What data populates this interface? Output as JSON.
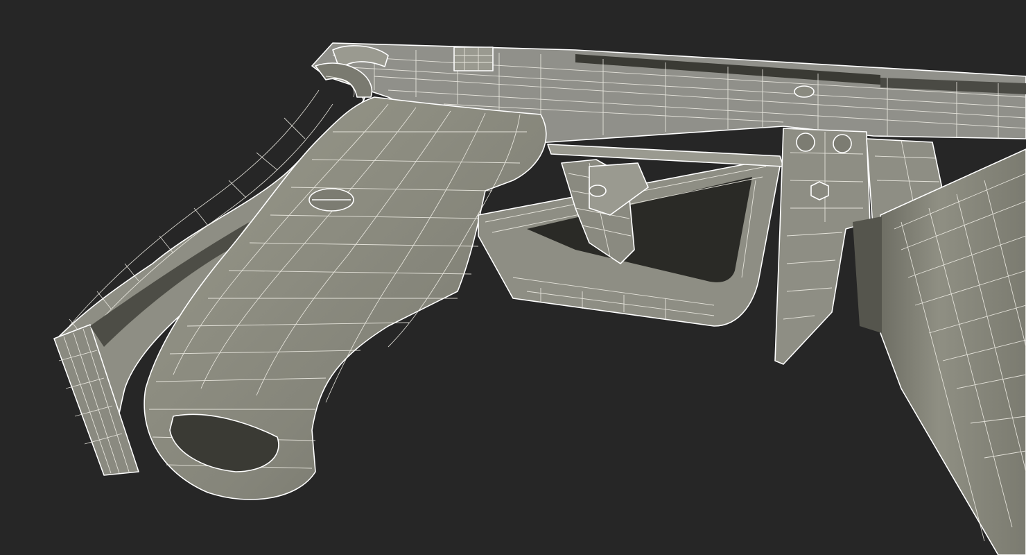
{
  "scene": {
    "background_color": "#262626",
    "mesh_color": "#8d8d80",
    "mesh_shadow_color": "#5f5f56",
    "mesh_dark_color": "#3e3e38",
    "wire_color": "#f4f2ea",
    "render_mode": "wireframe-on-shaded"
  }
}
